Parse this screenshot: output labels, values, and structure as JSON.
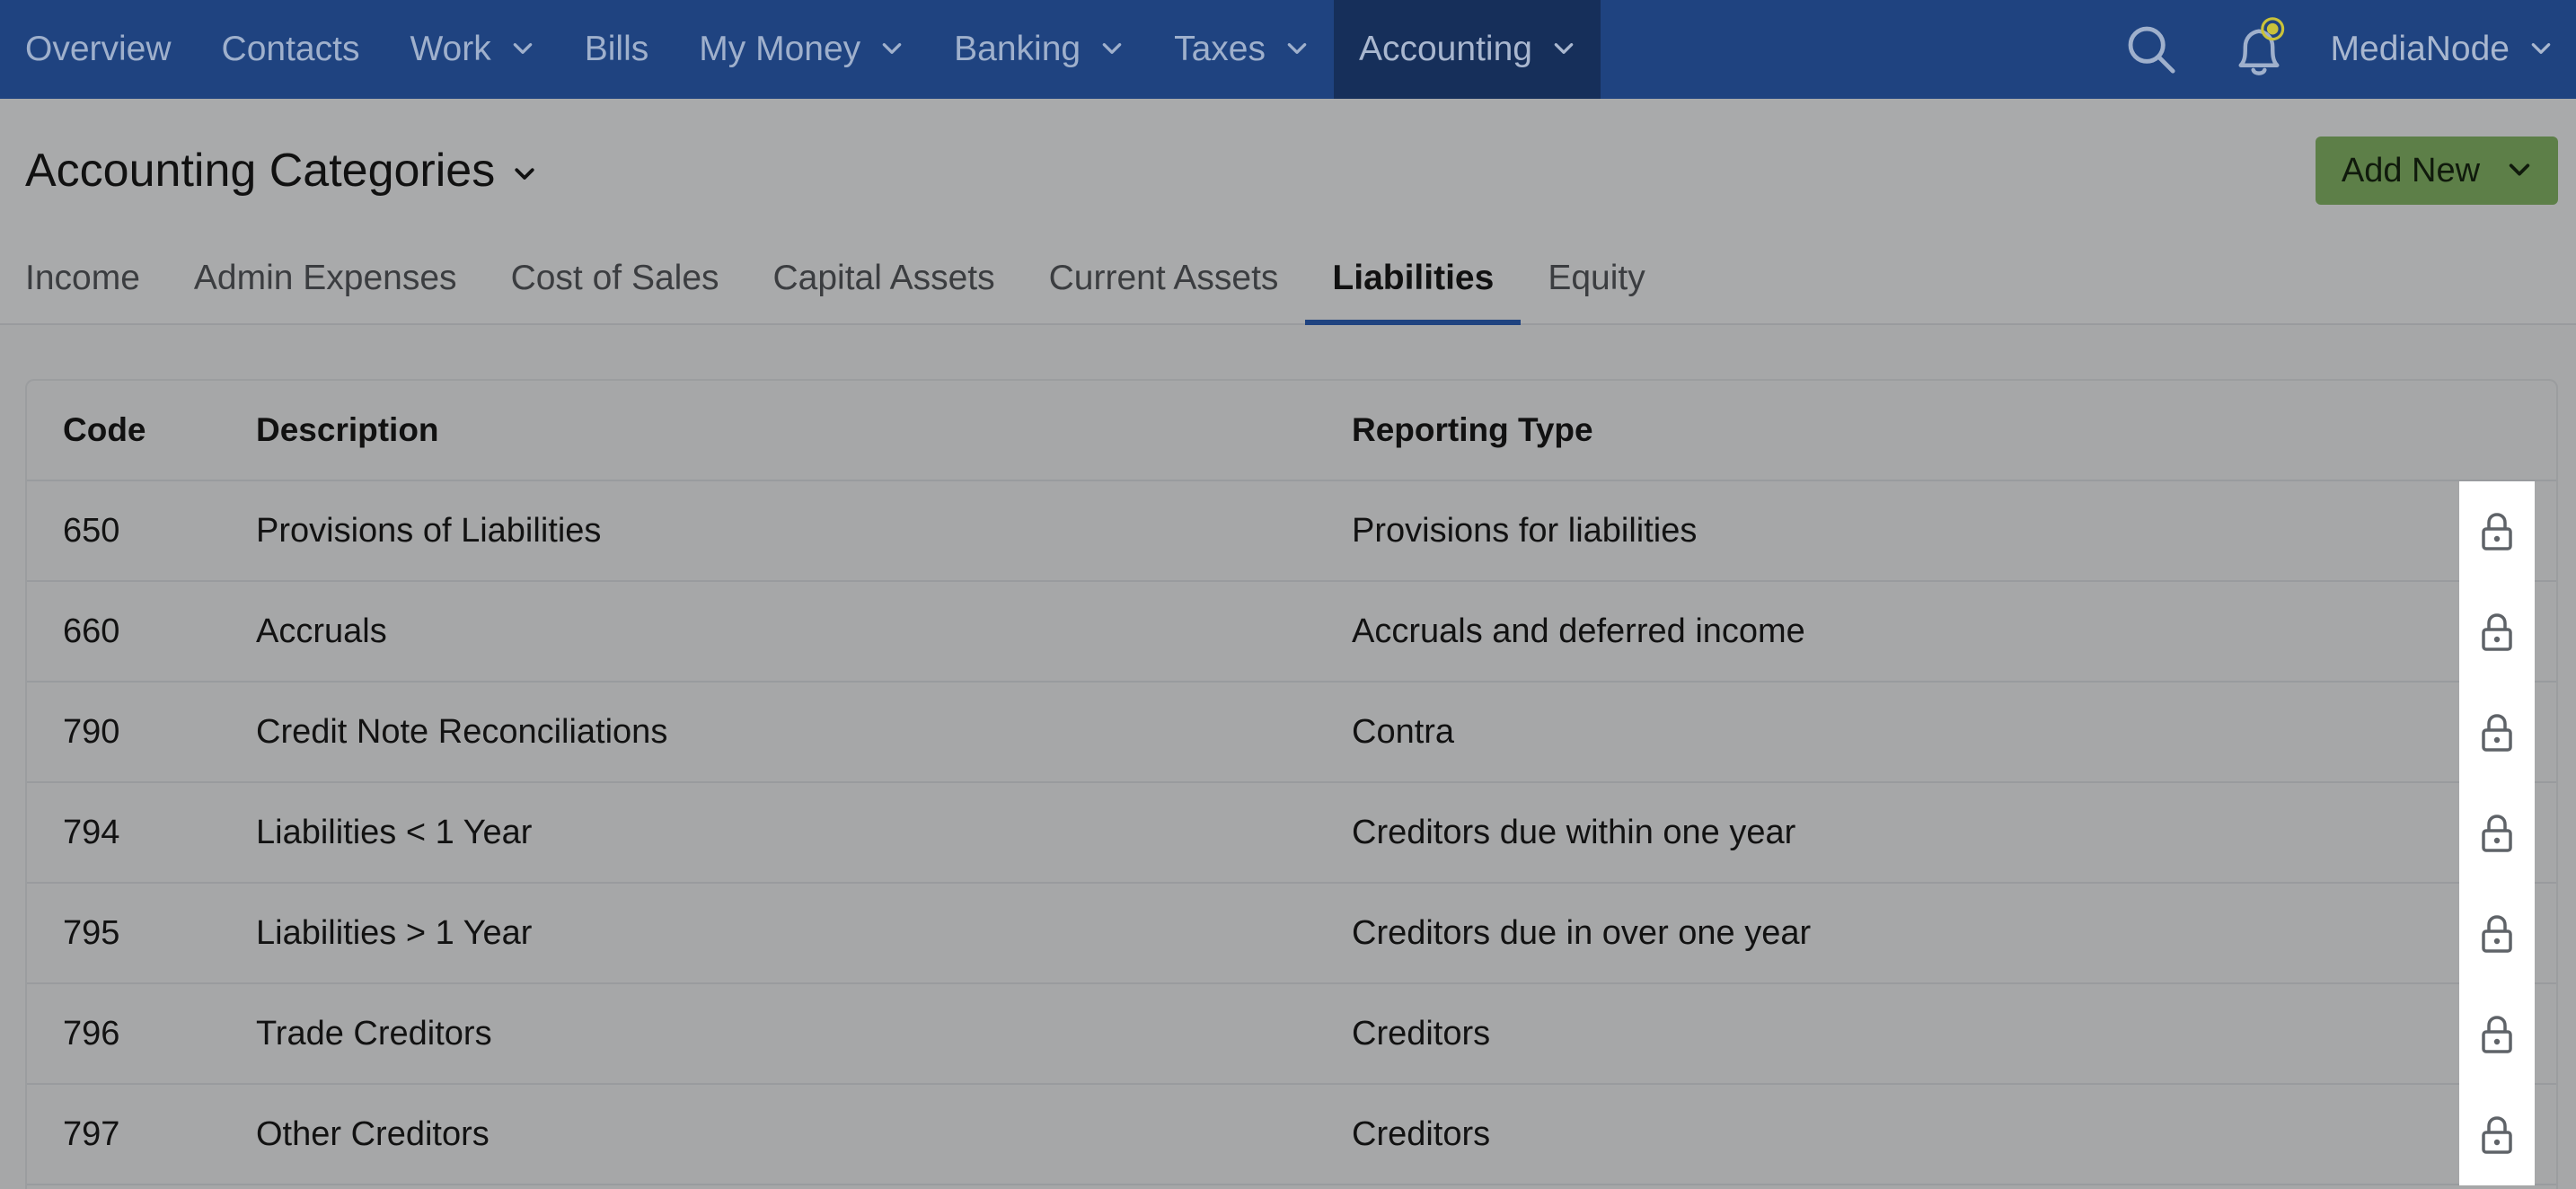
{
  "nav": {
    "items": [
      {
        "label": "Overview",
        "dropdown": false,
        "active": false
      },
      {
        "label": "Contacts",
        "dropdown": false,
        "active": false
      },
      {
        "label": "Work",
        "dropdown": true,
        "active": false
      },
      {
        "label": "Bills",
        "dropdown": false,
        "active": false
      },
      {
        "label": "My Money",
        "dropdown": true,
        "active": false
      },
      {
        "label": "Banking",
        "dropdown": true,
        "active": false
      },
      {
        "label": "Taxes",
        "dropdown": true,
        "active": false
      },
      {
        "label": "Accounting",
        "dropdown": true,
        "active": true
      }
    ],
    "search_icon": "search-icon",
    "notification_icon": "bell-icon",
    "user_label": "MediaNode"
  },
  "header": {
    "title": "Accounting Categories",
    "add_new_label": "Add New"
  },
  "tabs": [
    {
      "label": "Income",
      "active": false
    },
    {
      "label": "Admin Expenses",
      "active": false
    },
    {
      "label": "Cost of Sales",
      "active": false
    },
    {
      "label": "Capital Assets",
      "active": false
    },
    {
      "label": "Current Assets",
      "active": false
    },
    {
      "label": "Liabilities",
      "active": true
    },
    {
      "label": "Equity",
      "active": false
    }
  ],
  "table": {
    "columns": {
      "code": "Code",
      "description": "Description",
      "reporting_type": "Reporting Type"
    },
    "rows": [
      {
        "code": "650",
        "description": "Provisions of Liabilities",
        "reporting_type": "Provisions for liabilities",
        "locked": true
      },
      {
        "code": "660",
        "description": "Accruals",
        "reporting_type": "Accruals and deferred income",
        "locked": true
      },
      {
        "code": "790",
        "description": "Credit Note Reconciliations",
        "reporting_type": "Contra",
        "locked": true
      },
      {
        "code": "794",
        "description": "Liabilities < 1 Year",
        "reporting_type": "Creditors due within one year",
        "locked": true
      },
      {
        "code": "795",
        "description": "Liabilities > 1 Year",
        "reporting_type": "Creditors due in over one year",
        "locked": true
      },
      {
        "code": "796",
        "description": "Trade Creditors",
        "reporting_type": "Creditors",
        "locked": true
      },
      {
        "code": "797",
        "description": "Other Creditors",
        "reporting_type": "Creditors",
        "locked": true
      }
    ]
  },
  "colors": {
    "nav_bg": "#1f4380",
    "nav_active_bg": "#162f5a",
    "add_new_bg": "#5d7f48",
    "tab_active_underline": "#1f4380",
    "notification_dot": "#c9c23a"
  }
}
